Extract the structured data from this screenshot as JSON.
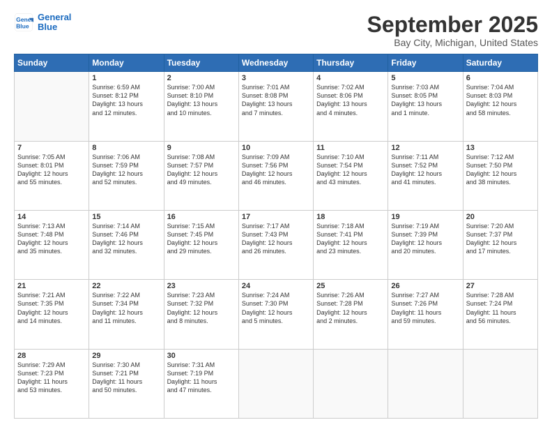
{
  "header": {
    "logo_line1": "General",
    "logo_line2": "Blue",
    "main_title": "September 2025",
    "subtitle": "Bay City, Michigan, United States"
  },
  "calendar": {
    "days_of_week": [
      "Sunday",
      "Monday",
      "Tuesday",
      "Wednesday",
      "Thursday",
      "Friday",
      "Saturday"
    ],
    "weeks": [
      [
        {
          "day": "",
          "info": ""
        },
        {
          "day": "1",
          "info": "Sunrise: 6:59 AM\nSunset: 8:12 PM\nDaylight: 13 hours\nand 12 minutes."
        },
        {
          "day": "2",
          "info": "Sunrise: 7:00 AM\nSunset: 8:10 PM\nDaylight: 13 hours\nand 10 minutes."
        },
        {
          "day": "3",
          "info": "Sunrise: 7:01 AM\nSunset: 8:08 PM\nDaylight: 13 hours\nand 7 minutes."
        },
        {
          "day": "4",
          "info": "Sunrise: 7:02 AM\nSunset: 8:06 PM\nDaylight: 13 hours\nand 4 minutes."
        },
        {
          "day": "5",
          "info": "Sunrise: 7:03 AM\nSunset: 8:05 PM\nDaylight: 13 hours\nand 1 minute."
        },
        {
          "day": "6",
          "info": "Sunrise: 7:04 AM\nSunset: 8:03 PM\nDaylight: 12 hours\nand 58 minutes."
        }
      ],
      [
        {
          "day": "7",
          "info": "Sunrise: 7:05 AM\nSunset: 8:01 PM\nDaylight: 12 hours\nand 55 minutes."
        },
        {
          "day": "8",
          "info": "Sunrise: 7:06 AM\nSunset: 7:59 PM\nDaylight: 12 hours\nand 52 minutes."
        },
        {
          "day": "9",
          "info": "Sunrise: 7:08 AM\nSunset: 7:57 PM\nDaylight: 12 hours\nand 49 minutes."
        },
        {
          "day": "10",
          "info": "Sunrise: 7:09 AM\nSunset: 7:56 PM\nDaylight: 12 hours\nand 46 minutes."
        },
        {
          "day": "11",
          "info": "Sunrise: 7:10 AM\nSunset: 7:54 PM\nDaylight: 12 hours\nand 43 minutes."
        },
        {
          "day": "12",
          "info": "Sunrise: 7:11 AM\nSunset: 7:52 PM\nDaylight: 12 hours\nand 41 minutes."
        },
        {
          "day": "13",
          "info": "Sunrise: 7:12 AM\nSunset: 7:50 PM\nDaylight: 12 hours\nand 38 minutes."
        }
      ],
      [
        {
          "day": "14",
          "info": "Sunrise: 7:13 AM\nSunset: 7:48 PM\nDaylight: 12 hours\nand 35 minutes."
        },
        {
          "day": "15",
          "info": "Sunrise: 7:14 AM\nSunset: 7:46 PM\nDaylight: 12 hours\nand 32 minutes."
        },
        {
          "day": "16",
          "info": "Sunrise: 7:15 AM\nSunset: 7:45 PM\nDaylight: 12 hours\nand 29 minutes."
        },
        {
          "day": "17",
          "info": "Sunrise: 7:17 AM\nSunset: 7:43 PM\nDaylight: 12 hours\nand 26 minutes."
        },
        {
          "day": "18",
          "info": "Sunrise: 7:18 AM\nSunset: 7:41 PM\nDaylight: 12 hours\nand 23 minutes."
        },
        {
          "day": "19",
          "info": "Sunrise: 7:19 AM\nSunset: 7:39 PM\nDaylight: 12 hours\nand 20 minutes."
        },
        {
          "day": "20",
          "info": "Sunrise: 7:20 AM\nSunset: 7:37 PM\nDaylight: 12 hours\nand 17 minutes."
        }
      ],
      [
        {
          "day": "21",
          "info": "Sunrise: 7:21 AM\nSunset: 7:35 PM\nDaylight: 12 hours\nand 14 minutes."
        },
        {
          "day": "22",
          "info": "Sunrise: 7:22 AM\nSunset: 7:34 PM\nDaylight: 12 hours\nand 11 minutes."
        },
        {
          "day": "23",
          "info": "Sunrise: 7:23 AM\nSunset: 7:32 PM\nDaylight: 12 hours\nand 8 minutes."
        },
        {
          "day": "24",
          "info": "Sunrise: 7:24 AM\nSunset: 7:30 PM\nDaylight: 12 hours\nand 5 minutes."
        },
        {
          "day": "25",
          "info": "Sunrise: 7:26 AM\nSunset: 7:28 PM\nDaylight: 12 hours\nand 2 minutes."
        },
        {
          "day": "26",
          "info": "Sunrise: 7:27 AM\nSunset: 7:26 PM\nDaylight: 11 hours\nand 59 minutes."
        },
        {
          "day": "27",
          "info": "Sunrise: 7:28 AM\nSunset: 7:24 PM\nDaylight: 11 hours\nand 56 minutes."
        }
      ],
      [
        {
          "day": "28",
          "info": "Sunrise: 7:29 AM\nSunset: 7:23 PM\nDaylight: 11 hours\nand 53 minutes."
        },
        {
          "day": "29",
          "info": "Sunrise: 7:30 AM\nSunset: 7:21 PM\nDaylight: 11 hours\nand 50 minutes."
        },
        {
          "day": "30",
          "info": "Sunrise: 7:31 AM\nSunset: 7:19 PM\nDaylight: 11 hours\nand 47 minutes."
        },
        {
          "day": "",
          "info": ""
        },
        {
          "day": "",
          "info": ""
        },
        {
          "day": "",
          "info": ""
        },
        {
          "day": "",
          "info": ""
        }
      ]
    ]
  }
}
